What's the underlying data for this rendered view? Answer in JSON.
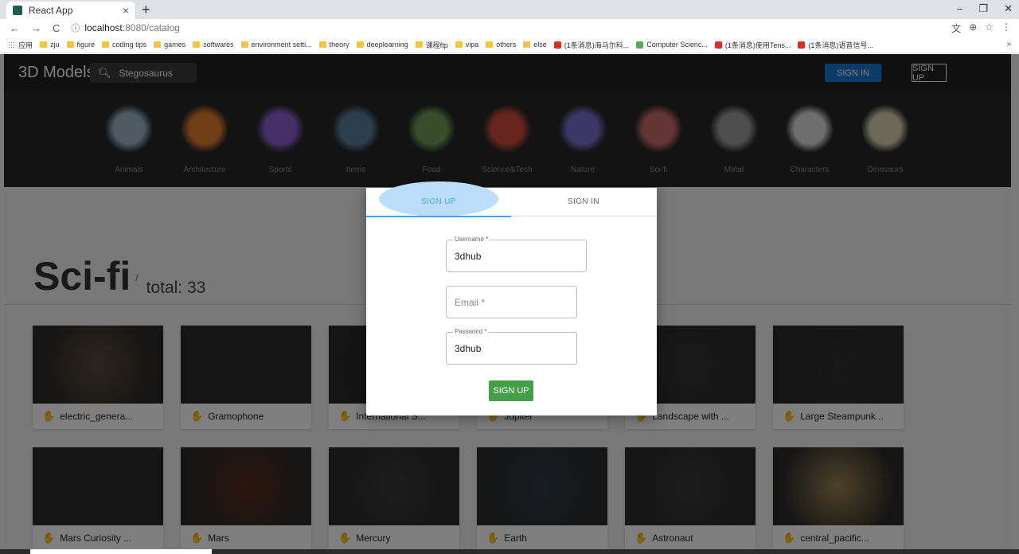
{
  "browser": {
    "tab_title": "React App",
    "tab_close": "×",
    "new_tab": "+",
    "win_min": "–",
    "win_max": "❐",
    "win_close": "✕",
    "url_host": "localhost",
    "url_path": ":8080/catalog",
    "back": "←",
    "forward": "→",
    "reload": "C",
    "info": "ⓘ",
    "bookmarks": [
      "应用",
      "zju",
      "figure",
      "coding tips",
      "games",
      "softwares",
      "environment setti...",
      "theory",
      "deeplearning",
      "课程ftp",
      "vipa",
      "others",
      "else",
      "(1条消息)海马尔科...",
      "Computer Scienc...",
      "(1条消息)使用Tens...",
      "(1条消息)语音信号..."
    ],
    "more": "»"
  },
  "appbar": {
    "brand": "3D Models",
    "search_value": "Stegosaurus",
    "signin": "SIGN IN",
    "signup": "SIGN UP"
  },
  "categories": [
    {
      "label": "Animals",
      "color": "#9ab3c7"
    },
    {
      "label": "Architecture",
      "color": "#e07a2e"
    },
    {
      "label": "Sports",
      "color": "#8d5fd3"
    },
    {
      "label": "Items",
      "color": "#5b7f9a"
    },
    {
      "label": "Food",
      "color": "#6f9b56"
    },
    {
      "label": "Science&Tech",
      "color": "#d04b3c"
    },
    {
      "label": "Nature",
      "color": "#7b6fd0"
    },
    {
      "label": "Sci-fi",
      "color": "#c96a6a"
    },
    {
      "label": "Metal",
      "color": "#9a9a9a"
    },
    {
      "label": "Characters",
      "color": "#dcdcdc"
    },
    {
      "label": "Dinosaurs",
      "color": "#d8d2b0"
    }
  ],
  "page": {
    "title": "Sci-fi",
    "slash": "/",
    "total": "total: 33"
  },
  "models": [
    {
      "name": "electric_genera...",
      "color": "#5a4a3a"
    },
    {
      "name": "Gramophone",
      "color": "#2a2a2a"
    },
    {
      "name": "International S...",
      "color": "#262626"
    },
    {
      "name": "Jupiter",
      "color": "#2a2a2a"
    },
    {
      "name": "Landscape with ...",
      "color": "#333"
    },
    {
      "name": "Large Steampunk...",
      "color": "#303030"
    },
    {
      "name": "Mars Curiosity ...",
      "color": "#2c2c2c"
    },
    {
      "name": "Mars",
      "color": "#5a2a1a"
    },
    {
      "name": "Mercury",
      "color": "#3a3a3a"
    },
    {
      "name": "Earth",
      "color": "#2f3a44"
    },
    {
      "name": "Astronaut",
      "color": "#3a3a3a"
    },
    {
      "name": "central_pacific...",
      "color": "#9a8450"
    }
  ],
  "dialog": {
    "tab_signup": "SIGN UP",
    "tab_signin": "SIGN IN",
    "username_label": "Username *",
    "username_value": "3dhub",
    "email_placeholder": "Email *",
    "password_label": "Password *",
    "password_value": "3dhub",
    "submit": "SIGN UP"
  },
  "colors": {
    "accent_blue": "#1976d2",
    "tab_active": "#42a5f5",
    "submit_green": "#43a047"
  }
}
